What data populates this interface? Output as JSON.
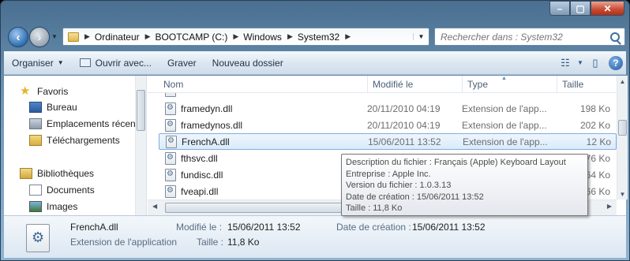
{
  "window": {
    "caption": {
      "minimize": "–",
      "maximize": "▢",
      "close": "✕"
    }
  },
  "navigation": {
    "breadcrumb": [
      "Ordinateur",
      "BOOTCAMP (C:)",
      "Windows",
      "System32"
    ],
    "search_placeholder": "Rechercher dans : System32"
  },
  "toolbar": {
    "organize": "Organiser",
    "open_with": "Ouvrir avec...",
    "burn": "Graver",
    "new_folder": "Nouveau dossier"
  },
  "sidebar": {
    "items": [
      {
        "label": "Favoris",
        "icon": "star-icon"
      },
      {
        "label": "Bureau",
        "icon": "desktop-icon"
      },
      {
        "label": "Emplacements récents",
        "icon": "recent-places-icon"
      },
      {
        "label": "Téléchargements",
        "icon": "downloads-icon"
      },
      {
        "label": "Bibliothèques",
        "icon": "libraries-icon"
      },
      {
        "label": "Documents",
        "icon": "documents-icon"
      },
      {
        "label": "Images",
        "icon": "pictures-icon"
      }
    ]
  },
  "columns": {
    "name": "Nom",
    "modified": "Modifié le",
    "type": "Type",
    "size": "Taille"
  },
  "files": [
    {
      "name": "framedyn.dll",
      "modified": "20/11/2010 04:19",
      "type": "Extension de l'app...",
      "size": "198 Ko"
    },
    {
      "name": "framedynos.dll",
      "modified": "20/11/2010 04:19",
      "type": "Extension de l'app...",
      "size": "202 Ko"
    },
    {
      "name": "FrenchA.dll",
      "modified": "15/06/2011 13:52",
      "type": "Extension de l'app...",
      "size": "12 Ko"
    },
    {
      "name": "fthsvc.dll",
      "modified": "",
      "type": "",
      "size": "76 Ko"
    },
    {
      "name": "fundisc.dll",
      "modified": "",
      "type": "",
      "size": "64 Ko"
    },
    {
      "name": "fveapi.dll",
      "modified": "",
      "type": "",
      "size": "66 Ko"
    }
  ],
  "tooltip": {
    "line1": "Description du fichier : Français (Apple) Keyboard Layout",
    "line2": "Entreprise : Apple Inc.",
    "line3": "Version du fichier : 1.0.3.13",
    "line4": "Date de création : 15/06/2011 13:52",
    "line5": "Taille : 11,8 Ko"
  },
  "details": {
    "filename": "FrenchA.dll",
    "filetype": "Extension de l'application",
    "modified_label": "Modifié le :",
    "modified_value": "15/06/2011 13:52",
    "size_label": "Taille :",
    "size_value": "11,8 Ko",
    "created_label": "Date de création :",
    "created_value": "15/06/2011 13:52"
  }
}
